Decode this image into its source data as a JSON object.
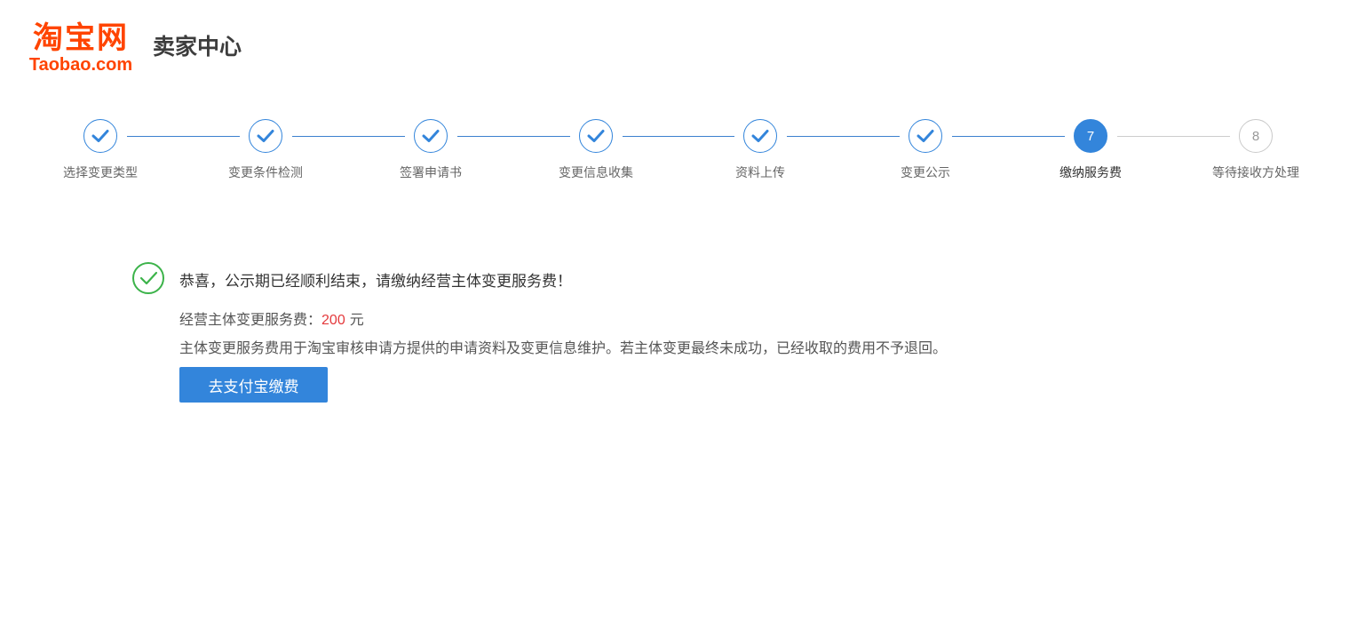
{
  "header": {
    "logo_cn": "淘宝网",
    "logo_en": "Taobao.com",
    "title": "卖家中心"
  },
  "stepper": {
    "steps": [
      {
        "label": "选择变更类型",
        "status": "done"
      },
      {
        "label": "变更条件检测",
        "status": "done"
      },
      {
        "label": "签署申请书",
        "status": "done"
      },
      {
        "label": "变更信息收集",
        "status": "done"
      },
      {
        "label": "资料上传",
        "status": "done"
      },
      {
        "label": "变更公示",
        "status": "done"
      },
      {
        "label": "缴纳服务费",
        "status": "current",
        "number": "7"
      },
      {
        "label": "等待接收方处理",
        "status": "todo",
        "number": "8"
      }
    ],
    "colors": {
      "active": "#3385db",
      "inactive": "#cccccc"
    }
  },
  "content": {
    "icon": "check-circle-icon",
    "icon_color": "#3cb34a",
    "message": "恭喜，公示期已经顺利结束，请缴纳经营主体变更服务费！",
    "fee_label": "经营主体变更服务费：",
    "fee_amount": "200",
    "fee_unit": " 元",
    "fee_amount_color": "#e4393c",
    "description": "主体变更服务费用于淘宝审核申请方提供的申请资料及变更信息维护。若主体变更最终未成功，已经收取的费用不予退回。",
    "pay_button_label": "去支付宝缴费"
  }
}
